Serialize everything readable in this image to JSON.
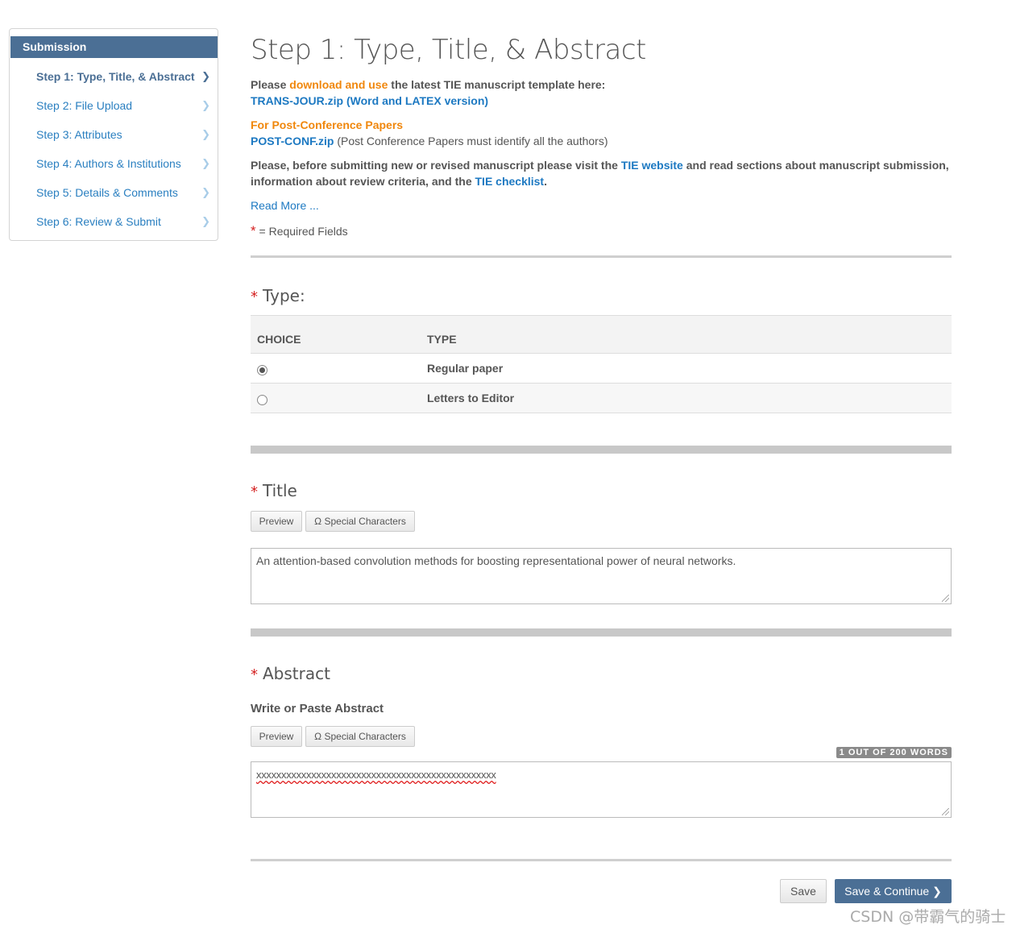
{
  "sidebar": {
    "header": "Submission",
    "items": [
      {
        "label": "Step 1: Type, Title, & Abstract",
        "active": true
      },
      {
        "label": "Step 2: File Upload"
      },
      {
        "label": "Step 3: Attributes"
      },
      {
        "label": "Step 4: Authors & Institutions"
      },
      {
        "label": "Step 5: Details & Comments"
      },
      {
        "label": "Step 6: Review & Submit"
      }
    ]
  },
  "main": {
    "title": "Step 1: Type, Title, & Abstract",
    "intro": {
      "please": "Please ",
      "download_link": "download and use",
      "rest": " the latest TIE manuscript template here:",
      "template_link": "TRANS-JOUR.zip (Word and LATEX version)"
    },
    "post_conf": {
      "heading": "For Post-Conference Papers",
      "link": "POST-CONF.zip",
      "note": " (Post Conference Papers must identify all the authors)"
    },
    "notice": {
      "part1": "Please, before submitting new or revised manuscript please visit the ",
      "website_link": "TIE website",
      "part2": " and read sections about manuscript submission,",
      "part3": "information about review criteria, and the ",
      "checklist_link": "TIE checklist",
      "part4": "."
    },
    "read_more": "Read More ...",
    "required_marker": "*",
    "required_text": "= Required Fields"
  },
  "type_section": {
    "title": "Type:",
    "columns": [
      "CHOICE",
      "TYPE"
    ],
    "rows": [
      {
        "label": "Regular paper",
        "checked": true
      },
      {
        "label": "Letters to Editor",
        "checked": false
      }
    ]
  },
  "title_section": {
    "title": "Title",
    "preview_label": "Preview",
    "special_chars_label": "Ω Special Characters",
    "value": "An attention-based convolution methods for boosting representational power of neural networks."
  },
  "abstract_section": {
    "title": "Abstract",
    "subtitle": "Write or Paste Abstract",
    "preview_label": "Preview",
    "special_chars_label": "Ω Special Characters",
    "word_count": "1 OUT OF 200 WORDS",
    "value": "xxxxxxxxxxxxxxxxxxxxxxxxxxxxxxxxxxxxxxxxxxxxxxxx"
  },
  "footer": {
    "save_label": "Save",
    "continue_label": "Save & Continue"
  },
  "watermark": "CSDN @带霸气的骑士",
  "colors": {
    "accent": "#4b6f95",
    "link": "#1d79c2",
    "highlight": "#f0870c",
    "required": "#d42020"
  }
}
